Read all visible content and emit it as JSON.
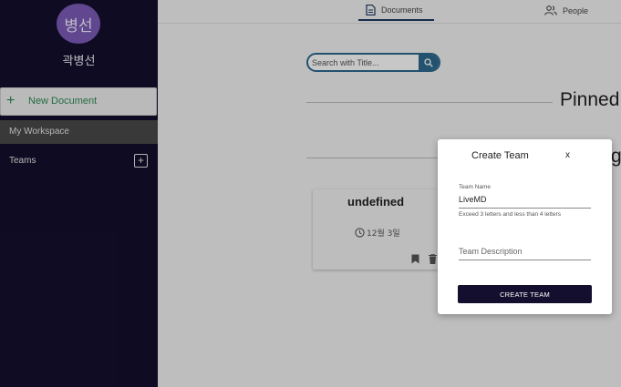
{
  "sidebar": {
    "avatar_text": "병선",
    "username": "곽병선",
    "new_document_icon": "+",
    "new_document_label": "New Document",
    "workspace_label": "My Workspace",
    "teams_label": "Teams",
    "teams_add_icon": "+"
  },
  "tabs": [
    {
      "label": "Documents",
      "icon": "document-icon",
      "active": true
    },
    {
      "label": "People",
      "icon": "people-icon",
      "active": false
    }
  ],
  "search": {
    "placeholder": "Search with Title...",
    "value": ""
  },
  "sections": {
    "pinned_title": "Pinned",
    "second_title_partial": "g"
  },
  "card": {
    "title": "undefined",
    "date": "12월 3일"
  },
  "modal": {
    "title": "Create Team",
    "close": "x",
    "team_name_label": "Team Name",
    "team_name_value": "LiveMD",
    "team_name_helper": "Exceed 3 letters and less than 4 letters",
    "description_placeholder": "Team Description",
    "submit_label": "CREATE TEAM"
  },
  "colors": {
    "sidebar_bg": "#140f2e",
    "avatar_bg": "#7c5bb8",
    "accent_green": "#2e8b57",
    "search_border": "#2d6a8e"
  }
}
